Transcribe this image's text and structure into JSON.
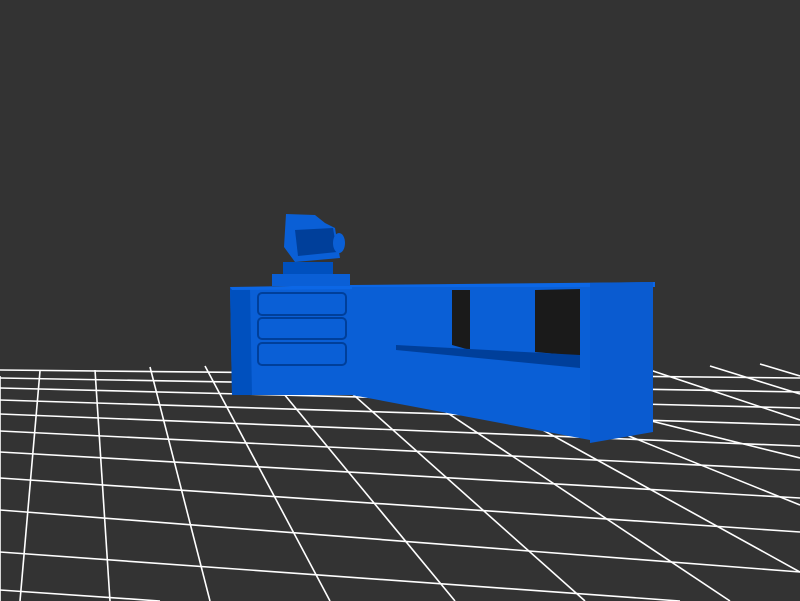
{
  "scene": {
    "background_color": "#333333",
    "grid_color": "#ffffff",
    "model_color": "#0a5fd6",
    "model_shadow_color": "#0044a3",
    "model_highlight_color": "#2b7cff"
  }
}
